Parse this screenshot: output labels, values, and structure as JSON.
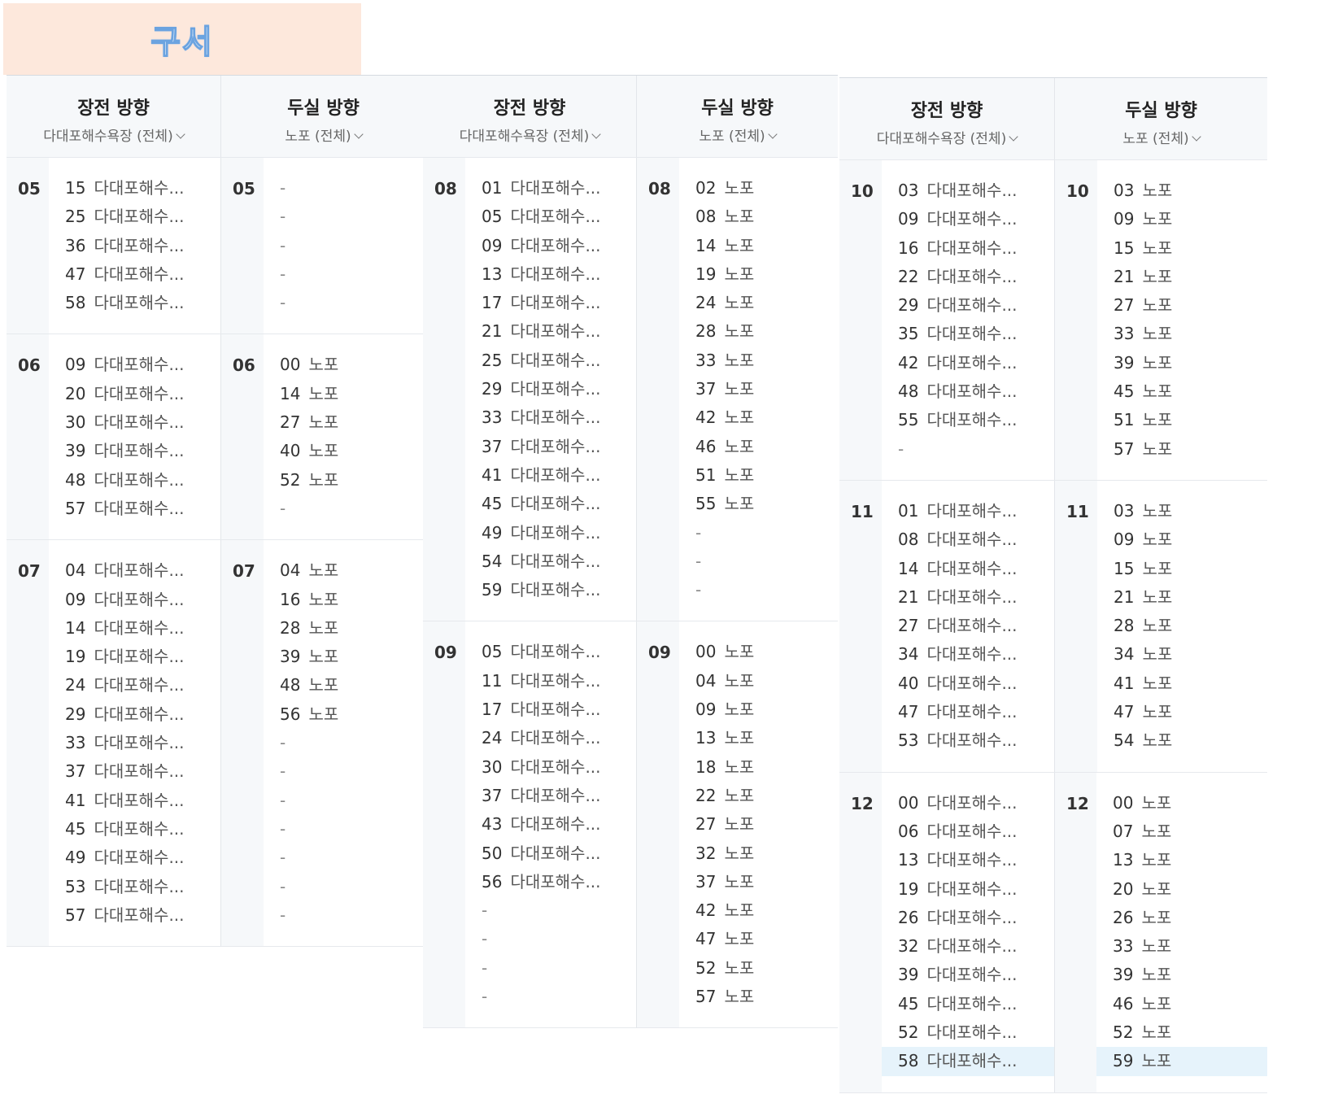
{
  "badge_text": "구서",
  "header": {
    "left_title": "장전 방향",
    "left_sub": "다대포해수욕장 (전체)",
    "right_title": "두실 방향",
    "right_sub": "노포 (전체)"
  },
  "dest_left": "다대포해수...",
  "dest_right": "노포",
  "dash": "-",
  "panels": [
    {
      "hours": [
        {
          "hour": "05",
          "left": [
            "15",
            "25",
            "36",
            "47",
            "58"
          ],
          "right": [
            "-",
            "-",
            "-",
            "-",
            "-"
          ]
        },
        {
          "hour": "06",
          "left": [
            "09",
            "20",
            "30",
            "39",
            "48",
            "57"
          ],
          "right": [
            "00",
            "14",
            "27",
            "40",
            "52",
            "-"
          ]
        },
        {
          "hour": "07",
          "left": [
            "04",
            "09",
            "14",
            "19",
            "24",
            "29",
            "33",
            "37",
            "41",
            "45",
            "49",
            "53",
            "57"
          ],
          "right": [
            "04",
            "16",
            "28",
            "39",
            "48",
            "56",
            "-",
            "-",
            "-",
            "-",
            "-",
            "-",
            "-"
          ]
        }
      ]
    },
    {
      "hours": [
        {
          "hour": "08",
          "left": [
            "01",
            "05",
            "09",
            "13",
            "17",
            "21",
            "25",
            "29",
            "33",
            "37",
            "41",
            "45",
            "49",
            "54",
            "59"
          ],
          "right": [
            "02",
            "08",
            "14",
            "19",
            "24",
            "28",
            "33",
            "37",
            "42",
            "46",
            "51",
            "55",
            "-",
            "-",
            "-"
          ]
        },
        {
          "hour": "09",
          "left": [
            "05",
            "11",
            "17",
            "24",
            "30",
            "37",
            "43",
            "50",
            "56",
            "-",
            "-",
            "-",
            "-"
          ],
          "right": [
            "00",
            "04",
            "09",
            "13",
            "18",
            "22",
            "27",
            "32",
            "37",
            "42",
            "47",
            "52",
            "57"
          ]
        }
      ]
    },
    {
      "hours": [
        {
          "hour": "10",
          "left": [
            "03",
            "09",
            "16",
            "22",
            "29",
            "35",
            "42",
            "48",
            "55",
            "-"
          ],
          "right": [
            "03",
            "09",
            "15",
            "21",
            "27",
            "33",
            "39",
            "45",
            "51",
            "57"
          ]
        },
        {
          "hour": "11",
          "left": [
            "01",
            "08",
            "14",
            "21",
            "27",
            "34",
            "40",
            "47",
            "53"
          ],
          "right": [
            "03",
            "09",
            "15",
            "21",
            "28",
            "34",
            "41",
            "47",
            "54"
          ]
        },
        {
          "hour": "12",
          "left": [
            "00",
            "06",
            "13",
            "19",
            "26",
            "32",
            "39",
            "45",
            "52",
            "58"
          ],
          "right": [
            "00",
            "07",
            "13",
            "20",
            "26",
            "33",
            "39",
            "46",
            "52",
            "59"
          ]
        }
      ]
    }
  ],
  "highlight": {
    "panel": 2,
    "hour": "12",
    "left": "58",
    "right": "59"
  },
  "colors": {
    "badge_bg": "#fde8dc",
    "badge_text_stroke": "#6ba3e0",
    "highlight": "#e6f3fb",
    "header_bg": "#f6f8fa"
  }
}
